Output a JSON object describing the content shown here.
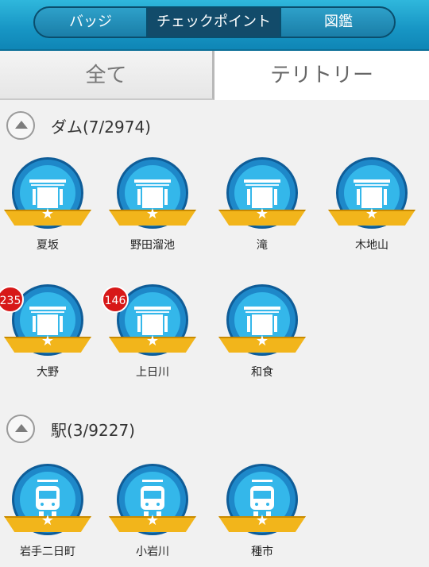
{
  "header": {
    "segments": [
      "バッジ",
      "チェックポイント",
      "図鑑"
    ],
    "active_index": 1
  },
  "tabs": {
    "all_label": "全て",
    "territory_label": "テリトリー",
    "active": "territory"
  },
  "sections": [
    {
      "title": "ダム(7/2974)",
      "type": "dam",
      "items": [
        {
          "name": "夏坂"
        },
        {
          "name": "野田溜池"
        },
        {
          "name": "滝"
        },
        {
          "name": "木地山"
        },
        {
          "name": "大野",
          "count": "235"
        },
        {
          "name": "上日川",
          "count": "146"
        },
        {
          "name": "和食"
        }
      ]
    },
    {
      "title": "駅(3/9227)",
      "type": "station",
      "items": [
        {
          "name": "岩手二日町"
        },
        {
          "name": "小岩川"
        },
        {
          "name": "種市"
        }
      ]
    }
  ],
  "colors": {
    "header": "#1795c4",
    "badge_outer": "#1e88c9",
    "badge_inner": "#34b7ea",
    "ribbon": "#f2b51b",
    "count_badge": "#d71818"
  },
  "icons": {
    "collapse": "chevron-up-icon",
    "dam": "dam-icon",
    "station": "train-icon",
    "star": "star-icon"
  }
}
